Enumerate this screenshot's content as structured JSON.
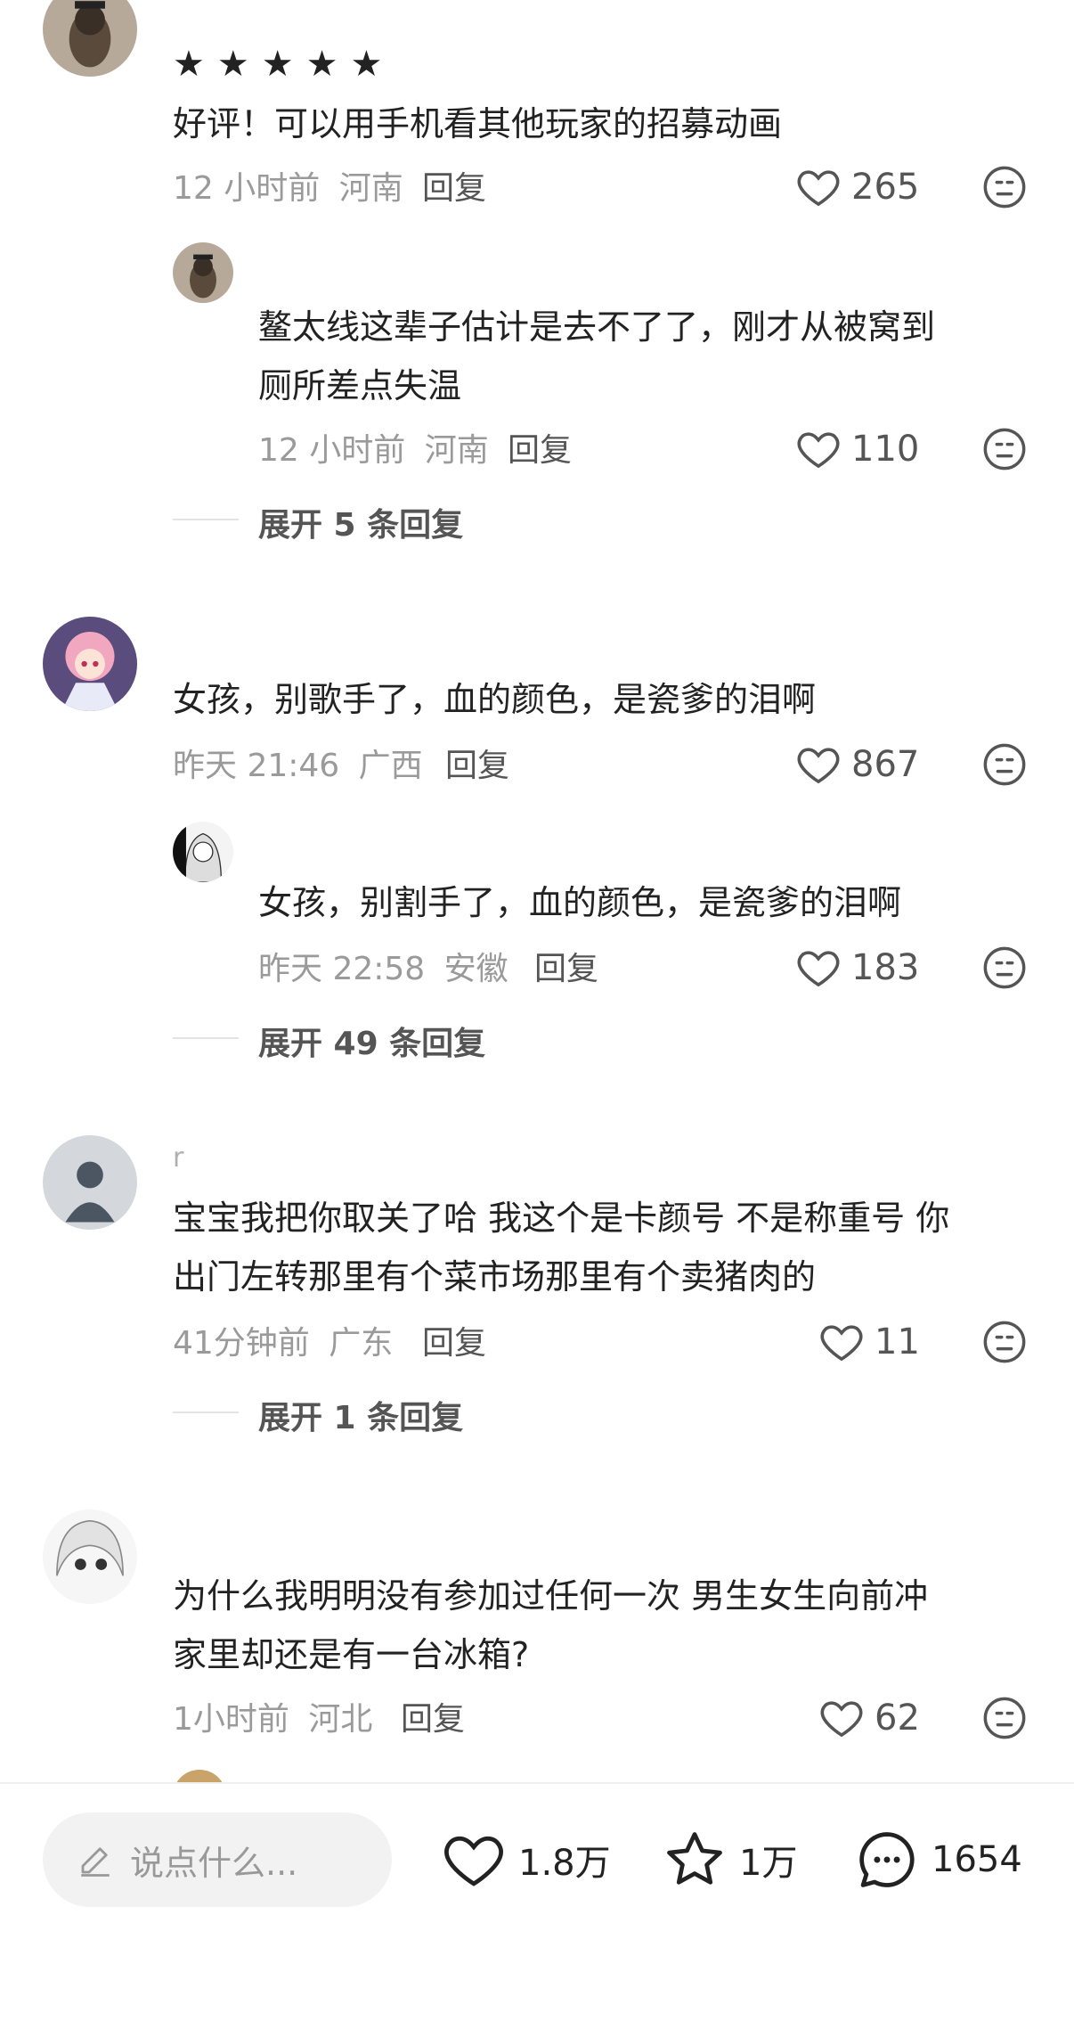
{
  "comments": [
    {
      "stars": "★★★★★",
      "text": "好评！可以用手机看其他玩家的招募动画",
      "time": "12 小时前",
      "location": "河南",
      "reply_label": "回复",
      "likes": "265",
      "reply": {
        "text_line1": "鳌太线这辈子估计是去不了了，刚才从被窝到",
        "text_line2": "厕所差点失温",
        "time": "12 小时前",
        "location": "河南",
        "reply_label": "回复",
        "likes": "110"
      },
      "expand": "展开 5 条回复"
    },
    {
      "text": "女孩，别歌手了，血的颜色，是瓷爹的泪啊",
      "time": "昨天 21:46",
      "location": "广西",
      "reply_label": "回复",
      "likes": "867",
      "reply": {
        "text_line1": "女孩，别割手了，血的颜色，是瓷爹的泪啊",
        "time": "昨天 22:58",
        "location": "安徽",
        "reply_label": "回复",
        "likes": "183"
      },
      "expand": "展开 49 条回复"
    },
    {
      "username": "r",
      "text_line1": "宝宝我把你取关了哈 我这个是卡颜号 不是称重号 你",
      "text_line2": "出门左转那里有个菜市场那里有个卖猪肉的",
      "time": "41分钟前",
      "location": "广东",
      "reply_label": "回复",
      "likes": "11",
      "expand": "展开 1 条回复"
    },
    {
      "text_line1": "为什么我明明没有参加过任何一次 男生女生向前冲",
      "text_line2": "家里却还是有一台冰箱?",
      "time": "1小时前",
      "location": "河北",
      "reply_label": "回复",
      "likes": "62"
    }
  ],
  "bottom": {
    "input_placeholder": "说点什么...",
    "likes": "1.8万",
    "favorites": "1万",
    "comments": "1654"
  },
  "icons": {
    "like": "heart-icon",
    "emoji": "emoji-face-icon",
    "favorite": "star-icon",
    "comment": "chat-bubble-icon",
    "edit": "pencil-icon"
  },
  "colors": {
    "meta_text": "#9a9a9a",
    "input_bg": "#f2f2f2"
  }
}
